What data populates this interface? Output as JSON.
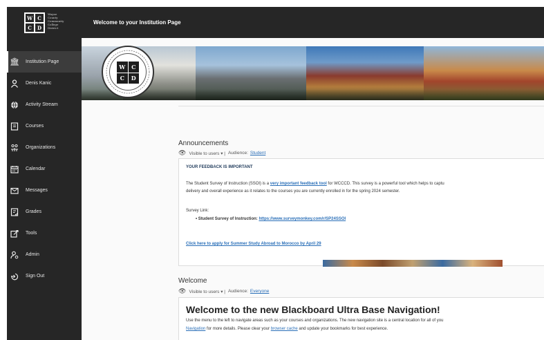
{
  "logo": {
    "letters": [
      "W",
      "C",
      "C",
      "D"
    ],
    "lines": [
      "Wayne",
      "County",
      "Community",
      "College",
      "District"
    ]
  },
  "header": {
    "title": "Welcome to your Institution Page"
  },
  "sidebar": {
    "items": [
      {
        "label": "Institution Page",
        "icon": "institution-icon",
        "active": true
      },
      {
        "label": "Denis Kanic",
        "icon": "user-icon"
      },
      {
        "label": "Activity Stream",
        "icon": "globe-icon"
      },
      {
        "label": "Courses",
        "icon": "courses-icon"
      },
      {
        "label": "Organizations",
        "icon": "organizations-icon"
      },
      {
        "label": "Calendar",
        "icon": "calendar-icon"
      },
      {
        "label": "Messages",
        "icon": "messages-icon"
      },
      {
        "label": "Grades",
        "icon": "grades-icon"
      },
      {
        "label": "Tools",
        "icon": "tools-icon"
      },
      {
        "label": "Admin",
        "icon": "admin-icon"
      },
      {
        "label": "Sign Out",
        "icon": "signout-icon"
      }
    ]
  },
  "announcements": {
    "heading": "Announcements",
    "visibility": "Visible to users ▾ |",
    "audience_label": "Audience:",
    "audience": "Student",
    "title": "YOUR FEEDBACK IS IMPORTANT",
    "body_prefix": "The Student Survey of Instruction (SSOI) is a ",
    "body_link": "very important feedback tool",
    "body_suffix": " for WCCCD. This survey is a powerful tool which helps to captu",
    "body_line2": "delivery and overall experience as it relates to the courses you are currently enrolled in for the spring 2024 semester.",
    "survey_label": "Survey Link:",
    "survey_item": "• Student Survey of Instruction: ",
    "survey_url": "https://www.surveymonkey.com/r/SP24SSOI",
    "abroad_link": "Click here to apply for Summer Study Abroad to Morocco by April 29"
  },
  "welcome": {
    "heading": "Welcome",
    "visibility": "Visible to users ▾ |",
    "audience_label": "Audience:",
    "audience": "Everyone",
    "title": "Welcome to the new Blackboard Ultra Base Navigation!",
    "line1": "Use the menu to the left to navigate areas such as your courses and organizations. The new navigation site is a central location for all of you",
    "line2_link1": "Navigation",
    "line2_mid": " for more details. Please clear your ",
    "line2_link2": "browser cache",
    "line2_end": " and update your bookmarks for best experience."
  },
  "colors": {
    "sidebar": "#262626",
    "accent_link": "#2a6fb8"
  }
}
